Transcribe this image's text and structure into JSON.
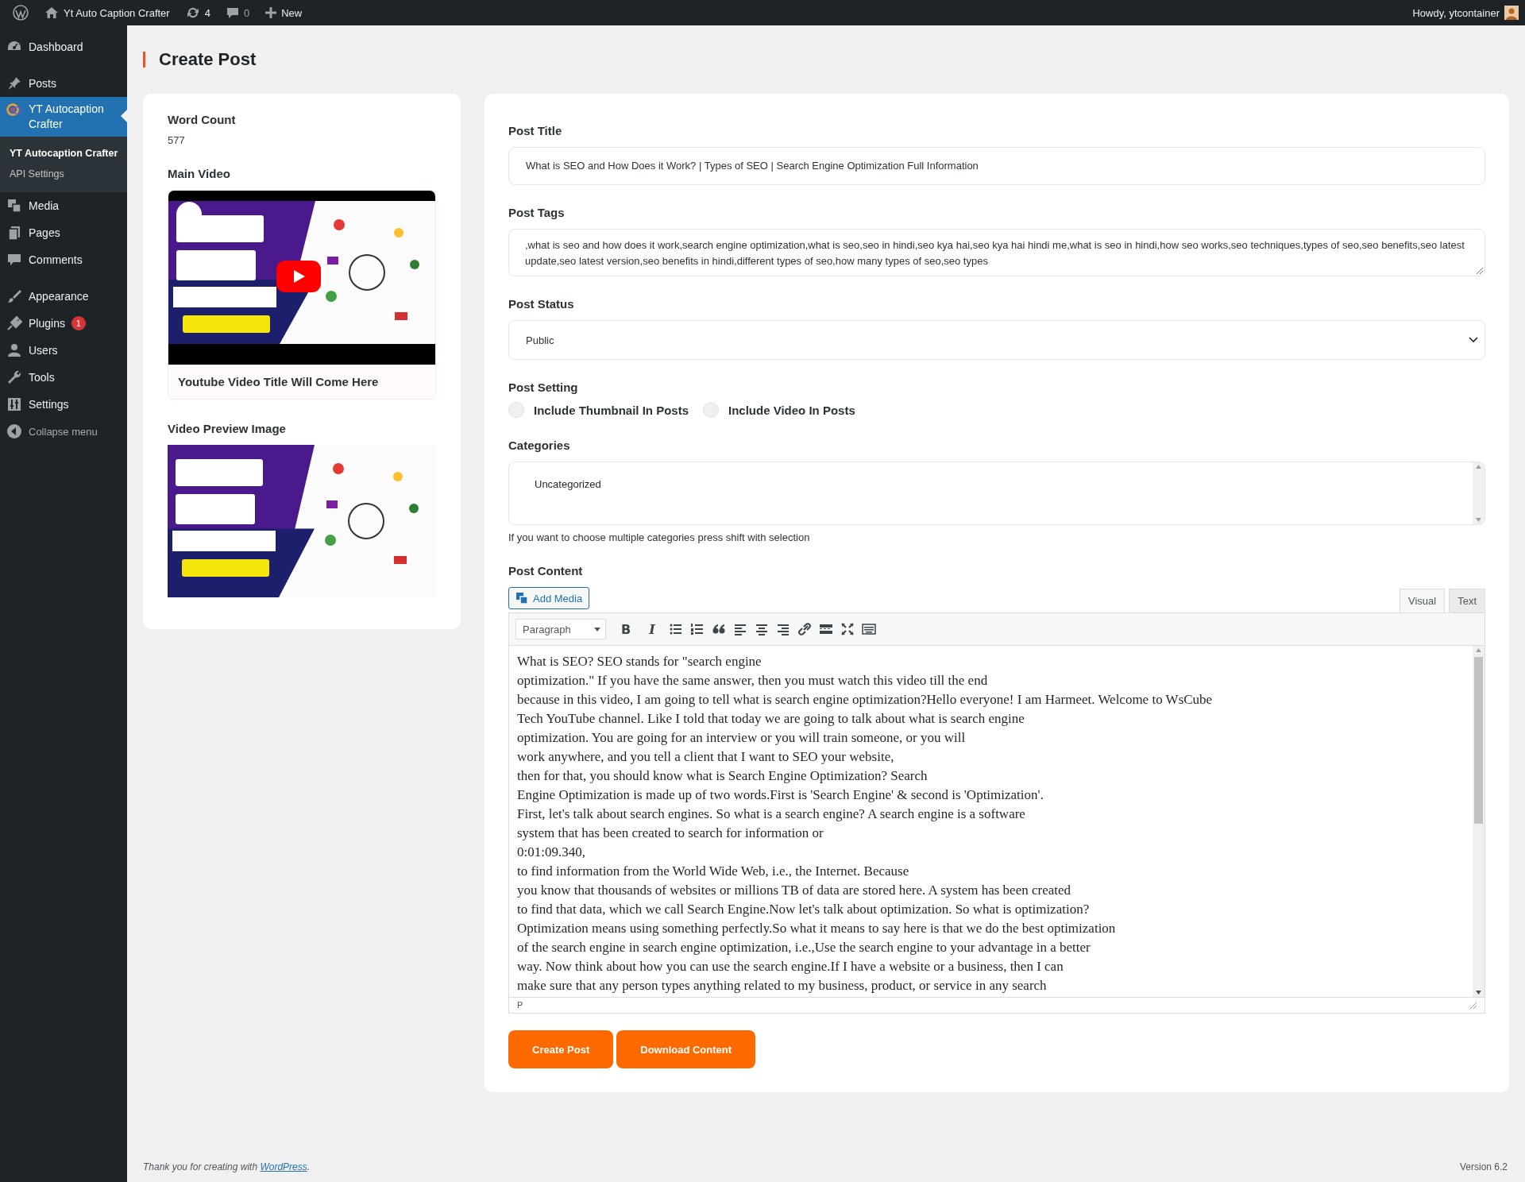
{
  "admin_bar": {
    "site_name": "Yt Auto Caption Crafter",
    "updates_count": "4",
    "comments_count": "0",
    "new_label": "New",
    "greeting": "Howdy, ytcontainer"
  },
  "sidebar": {
    "items": [
      {
        "label": "Dashboard",
        "kind": "dashboard",
        "selected": false
      },
      {
        "label": "Posts",
        "kind": "pin",
        "selected": false
      },
      {
        "label": "YT Autocaption Crafter",
        "kind": "logo",
        "selected": true,
        "children": [
          {
            "label": "YT Autocaption Crafter",
            "selected": true
          },
          {
            "label": "API Settings",
            "selected": false
          }
        ]
      },
      {
        "label": "Media",
        "kind": "media",
        "selected": false
      },
      {
        "label": "Pages",
        "kind": "pages",
        "selected": false
      },
      {
        "label": "Comments",
        "kind": "comments",
        "selected": false
      },
      {
        "label": "Appearance",
        "kind": "brush",
        "selected": false
      },
      {
        "label": "Plugins",
        "kind": "plug",
        "selected": false,
        "badge": "1"
      },
      {
        "label": "Users",
        "kind": "user",
        "selected": false
      },
      {
        "label": "Tools",
        "kind": "wrench",
        "selected": false
      },
      {
        "label": "Settings",
        "kind": "sliders",
        "selected": false
      }
    ],
    "collapse_label": "Collapse menu"
  },
  "page_title": "Create Post",
  "info_card": {
    "word_count_label": "Word Count",
    "word_count": "577",
    "main_video_label": "Main Video",
    "video_caption": "Youtube Video Title Will Come Here",
    "preview_label": "Video Preview Image"
  },
  "form": {
    "post_title": {
      "label": "Post Title",
      "value": "What is SEO and How Does it Work? | Types of SEO | Search Engine Optimization Full Information"
    },
    "post_tags": {
      "label": "Post Tags",
      "value": ",what is seo and how does it work,search engine optimization,what is seo,seo in hindi,seo kya hai,seo kya hai hindi me,what is seo in hindi,how seo works,seo techniques,types of seo,seo benefits,seo latest update,seo latest version,seo benefits in hindi,different types of seo,how many types of seo,seo types"
    },
    "post_status": {
      "label": "Post Status",
      "value": "Public"
    },
    "post_setting": {
      "label": "Post Setting",
      "options": [
        {
          "label": "Include Thumbnail In Posts",
          "checked": false
        },
        {
          "label": "Include Video In Posts",
          "checked": false
        }
      ]
    },
    "categories": {
      "label": "Categories",
      "options": [
        {
          "label": "Uncategorized",
          "selected": false
        }
      ],
      "hint": "If you want to choose multiple categories press shift with selection"
    },
    "post_content": {
      "label": "Post Content",
      "add_media_label": "Add Media",
      "tabs": [
        {
          "label": "Visual",
          "selected": true
        },
        {
          "label": "Text",
          "selected": false
        }
      ],
      "format": "Paragraph",
      "toolbar": [
        {
          "kind": "bold",
          "label": "B"
        },
        {
          "kind": "italic",
          "label": "I"
        },
        {
          "kind": "bullets"
        },
        {
          "kind": "numbers"
        },
        {
          "kind": "quote"
        },
        {
          "kind": "align-left"
        },
        {
          "kind": "align-center"
        },
        {
          "kind": "align-right"
        },
        {
          "kind": "link"
        },
        {
          "kind": "more"
        },
        {
          "kind": "fullscreen"
        },
        {
          "kind": "keyboard"
        }
      ],
      "lines": [
        "What is SEO? SEO stands for \"search engine",
        "optimization.\" If you have the same answer, then you must watch this video till the end",
        "because in this video, I am going to tell what is search engine optimization?Hello everyone! I am Harmeet. Welcome to WsCube",
        "Tech YouTube channel. Like I told that today we are going to talk about what is search engine",
        "optimization. You are going for an interview or you will train someone, or you will",
        "work anywhere, and you tell a client that I want to SEO your website,",
        "then for that, you should know what is Search Engine Optimization? Search",
        "Engine Optimization is made up of two words.First is 'Search Engine' & second is 'Optimization'.",
        "First, let's talk about search engines. So what is a search engine? A search engine is a software",
        "system that has been created to search for information or",
        "0:01:09.340,",
        "to find information from the World Wide Web, i.e., the Internet. Because",
        "you know that thousands of websites or millions TB of data are stored here. A system has been created",
        "to find that data, which we call Search Engine.Now let's talk about optimization. So what is optimization?",
        "Optimization means using something perfectly.So what it means to say here is that we do the best optimization",
        "of the search engine in search engine optimization, i.e.,Use the search engine to your advantage in a better",
        "way. Now think about how you can use the search engine.If I have a website or a business, then I can",
        "make sure that any person types anything related to my business, product, or service in any search"
      ],
      "path": "P"
    },
    "buttons": [
      "Create Post",
      "Download Content"
    ]
  },
  "footer": {
    "text_before": "Thank you for creating with",
    "link": "WordPress",
    "text_after": ".",
    "version": "Version 6.2"
  }
}
